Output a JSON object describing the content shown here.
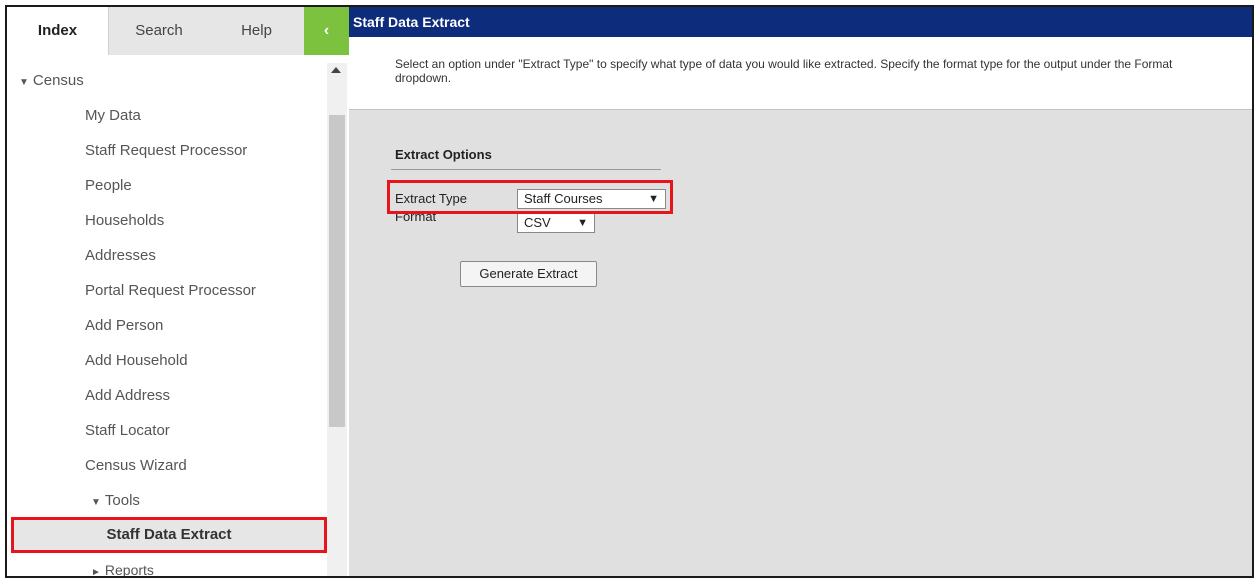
{
  "sidebar": {
    "tabs": [
      {
        "label": "Index"
      },
      {
        "label": "Search"
      },
      {
        "label": "Help"
      }
    ],
    "collapse_glyph": "‹",
    "tree": {
      "census": "Census",
      "items": [
        "My Data",
        "Staff Request Processor",
        "People",
        "Households",
        "Addresses",
        "Portal Request Processor",
        "Add Person",
        "Add Household",
        "Add Address",
        "Staff Locator",
        "Census Wizard"
      ],
      "tools": "Tools",
      "selected": "Staff Data Extract",
      "reports": "Reports"
    }
  },
  "main": {
    "title": "Staff Data Extract",
    "instruction": "Select an option under \"Extract Type\" to specify what type of data you would like extracted. Specify the format type for the output under the Format dropdown.",
    "options_title": "Extract Options",
    "extract_type_label": "Extract Type",
    "extract_type_value": "Staff Courses",
    "format_label": "Format",
    "format_value": "CSV",
    "generate_button": "Generate Extract"
  },
  "colors": {
    "header_bg": "#0d2c7c",
    "collapse_bg": "#7cc23f",
    "highlight": "#e8141c",
    "content_bg": "#e0e0e0"
  }
}
